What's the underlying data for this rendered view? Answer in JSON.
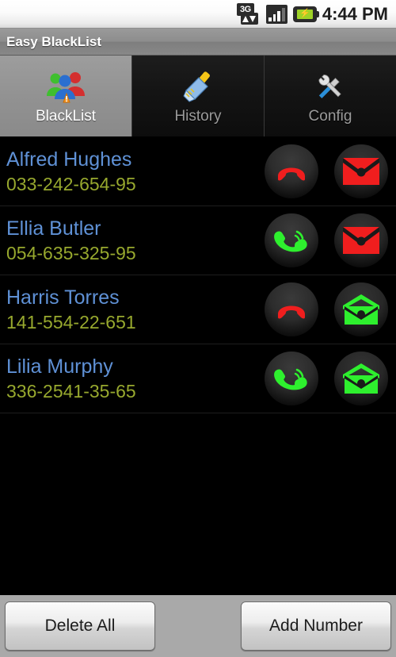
{
  "statusbar": {
    "network_icon": "3g-icon",
    "network_label": "3G",
    "signal_icon": "signal-bars-icon",
    "battery_icon": "battery-charging-icon",
    "battery_bolt": "⚡",
    "time": "4:44 PM"
  },
  "titlebar": {
    "title": "Easy BlackList"
  },
  "tabs": [
    {
      "label": "BlackList",
      "icon": "people-warning-icon",
      "active": true
    },
    {
      "label": "History",
      "icon": "broom-icon",
      "active": false
    },
    {
      "label": "Config",
      "icon": "wrench-screwdriver-icon",
      "active": false
    }
  ],
  "list": {
    "rows": [
      {
        "name": "Alfred Hughes",
        "number": "033-242-654-95",
        "call_icon": "phone-blocked-icon",
        "call_state": "blocked",
        "sms_icon": "envelope-closed-icon",
        "sms_state": "blocked"
      },
      {
        "name": "Ellia Butler",
        "number": "054-635-325-95",
        "call_icon": "phone-allowed-icon",
        "call_state": "allowed",
        "sms_icon": "envelope-closed-icon",
        "sms_state": "blocked"
      },
      {
        "name": "Harris Torres",
        "number": "141-554-22-651",
        "call_icon": "phone-blocked-icon",
        "call_state": "blocked",
        "sms_icon": "envelope-open-icon",
        "sms_state": "allowed"
      },
      {
        "name": "Lilia Murphy",
        "number": "336-2541-35-65",
        "call_icon": "phone-allowed-icon",
        "call_state": "allowed",
        "sms_icon": "envelope-open-icon",
        "sms_state": "allowed"
      }
    ]
  },
  "bottombar": {
    "delete_all_label": "Delete All",
    "add_number_label": "Add Number"
  },
  "colors": {
    "name_blue": "#5f91d6",
    "number_olive": "#97a82e",
    "blocked_red": "#f01e1e",
    "allowed_green": "#2ef02e",
    "battery_green": "#9fd327",
    "bottom_bar_gray": "#a9a9a9"
  }
}
